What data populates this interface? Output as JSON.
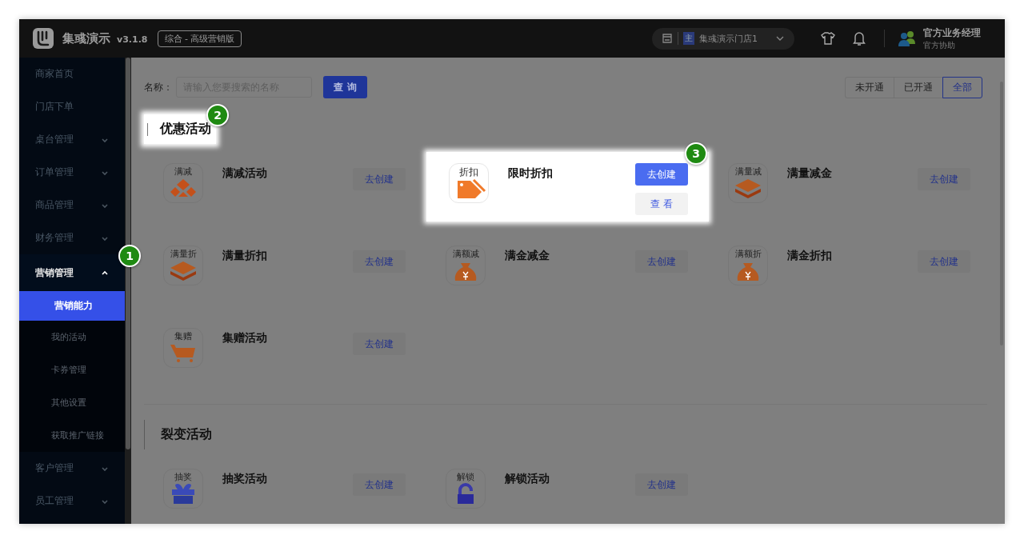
{
  "header": {
    "app_name": "集彧演示",
    "version": "v3.1.8",
    "edition": "综合 - 高级营销版",
    "store": {
      "badge": "主",
      "name": "集彧演示门店1"
    },
    "user": {
      "name": "官方业务经理",
      "role": "官方协助"
    }
  },
  "sidebar": {
    "items": [
      {
        "label": "商家首页",
        "kind": "link"
      },
      {
        "label": "门店下单",
        "kind": "link"
      },
      {
        "label": "桌台管理",
        "kind": "group",
        "expanded": false
      },
      {
        "label": "订单管理",
        "kind": "group",
        "expanded": false
      },
      {
        "label": "商品管理",
        "kind": "group",
        "expanded": false
      },
      {
        "label": "财务管理",
        "kind": "group",
        "expanded": false
      },
      {
        "label": "营销管理",
        "kind": "group",
        "expanded": true,
        "callout": "1",
        "children": [
          {
            "label": "营销能力",
            "selected": true
          },
          {
            "label": "我的活动",
            "selected": false
          },
          {
            "label": "卡券管理",
            "selected": false
          },
          {
            "label": "其他设置",
            "selected": false
          },
          {
            "label": "获取推广链接",
            "selected": false
          }
        ]
      },
      {
        "label": "客户管理",
        "kind": "group",
        "expanded": false
      },
      {
        "label": "员工管理",
        "kind": "group",
        "expanded": false
      }
    ]
  },
  "search": {
    "label": "名称：",
    "placeholder": "请输入您要搜索的名称",
    "button": "查 询"
  },
  "filter_tabs": [
    {
      "label": "未开通",
      "selected": false
    },
    {
      "label": "已开通",
      "selected": false
    },
    {
      "label": "全部",
      "selected": true
    }
  ],
  "sections": [
    {
      "title": "优惠活动",
      "highlighted": true,
      "callout": "2",
      "items": [
        {
          "icon_label": "满减",
          "kind": "bowl",
          "title": "满减活动",
          "highlighted": false,
          "buttons": [
            "去创建"
          ]
        },
        {
          "icon_label": "折扣",
          "kind": "tag",
          "title": "限时折扣",
          "highlighted": true,
          "callout": "3",
          "buttons": [
            "去创建",
            "查 看"
          ]
        },
        {
          "icon_label": "满量减",
          "kind": "layers",
          "title": "满量减金",
          "highlighted": false,
          "buttons": [
            "去创建"
          ]
        },
        {
          "icon_label": "满量折",
          "kind": "layers",
          "title": "满量折扣",
          "highlighted": false,
          "buttons": [
            "去创建"
          ]
        },
        {
          "icon_label": "满额减",
          "kind": "bag",
          "title": "满金减金",
          "highlighted": false,
          "buttons": [
            "去创建"
          ]
        },
        {
          "icon_label": "满额折",
          "kind": "bag",
          "title": "满金折扣",
          "highlighted": false,
          "buttons": [
            "去创建"
          ]
        },
        {
          "icon_label": "集赠",
          "kind": "cart",
          "title": "集赠活动",
          "highlighted": false,
          "buttons": [
            "去创建"
          ]
        }
      ]
    },
    {
      "title": "裂变活动",
      "highlighted": false,
      "items": [
        {
          "icon_label": "抽奖",
          "kind": "gift",
          "title": "抽奖活动",
          "highlighted": false,
          "buttons": [
            "去创建"
          ]
        },
        {
          "icon_label": "解锁",
          "kind": "lock",
          "title": "解锁活动",
          "highlighted": false,
          "buttons": [
            "去创建"
          ]
        }
      ]
    }
  ]
}
